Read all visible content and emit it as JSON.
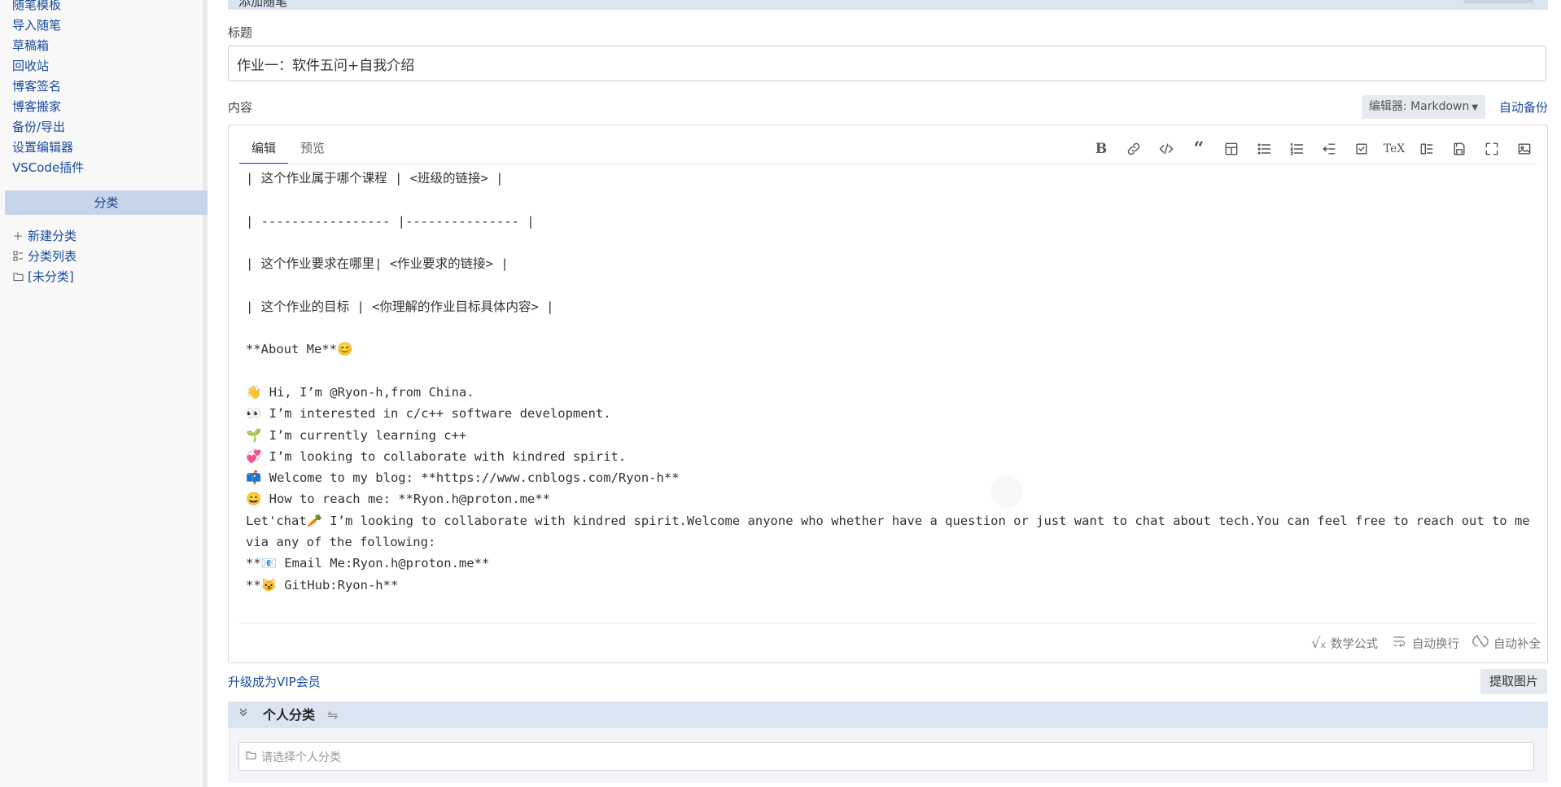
{
  "sidebar": {
    "links": [
      "随笔模板",
      "导入随笔",
      "草稿箱",
      "回收站",
      "博客签名",
      "博客搬家",
      "备份/导出",
      "设置编辑器",
      "VSCode插件"
    ],
    "category_header": "分类",
    "categories": [
      {
        "icon": "plus-icon",
        "label": "新建分类"
      },
      {
        "icon": "list-icon",
        "label": "分类列表"
      },
      {
        "icon": "folder-icon",
        "label": "[未分类]"
      }
    ]
  },
  "form": {
    "section_title": "添加随笔",
    "title_label": "标题",
    "title_value": "作业一：软件五问+自我介绍",
    "content_label": "内容",
    "editor_select_label": "编辑器: Markdown",
    "auto_backup_label": "自动备份",
    "tabs": [
      "编辑",
      "预览"
    ],
    "toolbar_icons": [
      "bold-icon",
      "link-icon",
      "code-icon",
      "quote-icon",
      "table-icon",
      "bullet-list-icon",
      "numbered-list-icon",
      "indent-icon",
      "task-list-icon",
      "tex-icon",
      "toc-icon",
      "save-icon",
      "fullscreen-icon",
      "image-icon"
    ],
    "content_lines": [
      "| 这个作业属于哪个课程 | <班级的链接> |",
      "",
      "| ----------------- |--------------- |",
      "",
      "| 这个作业要求在哪里| <作业要求的链接> |",
      "",
      "| 这个作业的目标 | <你理解的作业目标具体内容> |",
      "",
      "**About Me**😊",
      "",
      "👋 Hi, I’m @Ryon-h,from China.",
      "👀 I’m interested in c/c++ software development.",
      "🌱 I’m currently learning c++",
      "💞️ I’m looking to collaborate with kindred spirit.",
      "📫 Welcome to my blog: **https://www.cnblogs.com/Ryon-h**",
      "😄 How to reach me: **Ryon.h@proton.me**",
      "Let'chat🥕 I’m looking to collaborate with kindred spirit.Welcome anyone who whether have a question or just want to chat about tech.You can feel free to reach out to me via any of the following:",
      "**📧 Email Me:Ryon.h@proton.me**",
      "**😼 GitHub:Ryon-h**"
    ],
    "status_items": [
      {
        "icon": "sqrt-icon",
        "label": "数学公式"
      },
      {
        "icon": "wrap-icon",
        "label": "自动换行"
      },
      {
        "icon": "autocomplete-off-icon",
        "label": "自动补全"
      }
    ],
    "vip_link": "升级成为VIP会员",
    "extract_images_button": "提取图片",
    "personal_category_title": "个人分类",
    "personal_category_placeholder": "请选择个人分类"
  }
}
